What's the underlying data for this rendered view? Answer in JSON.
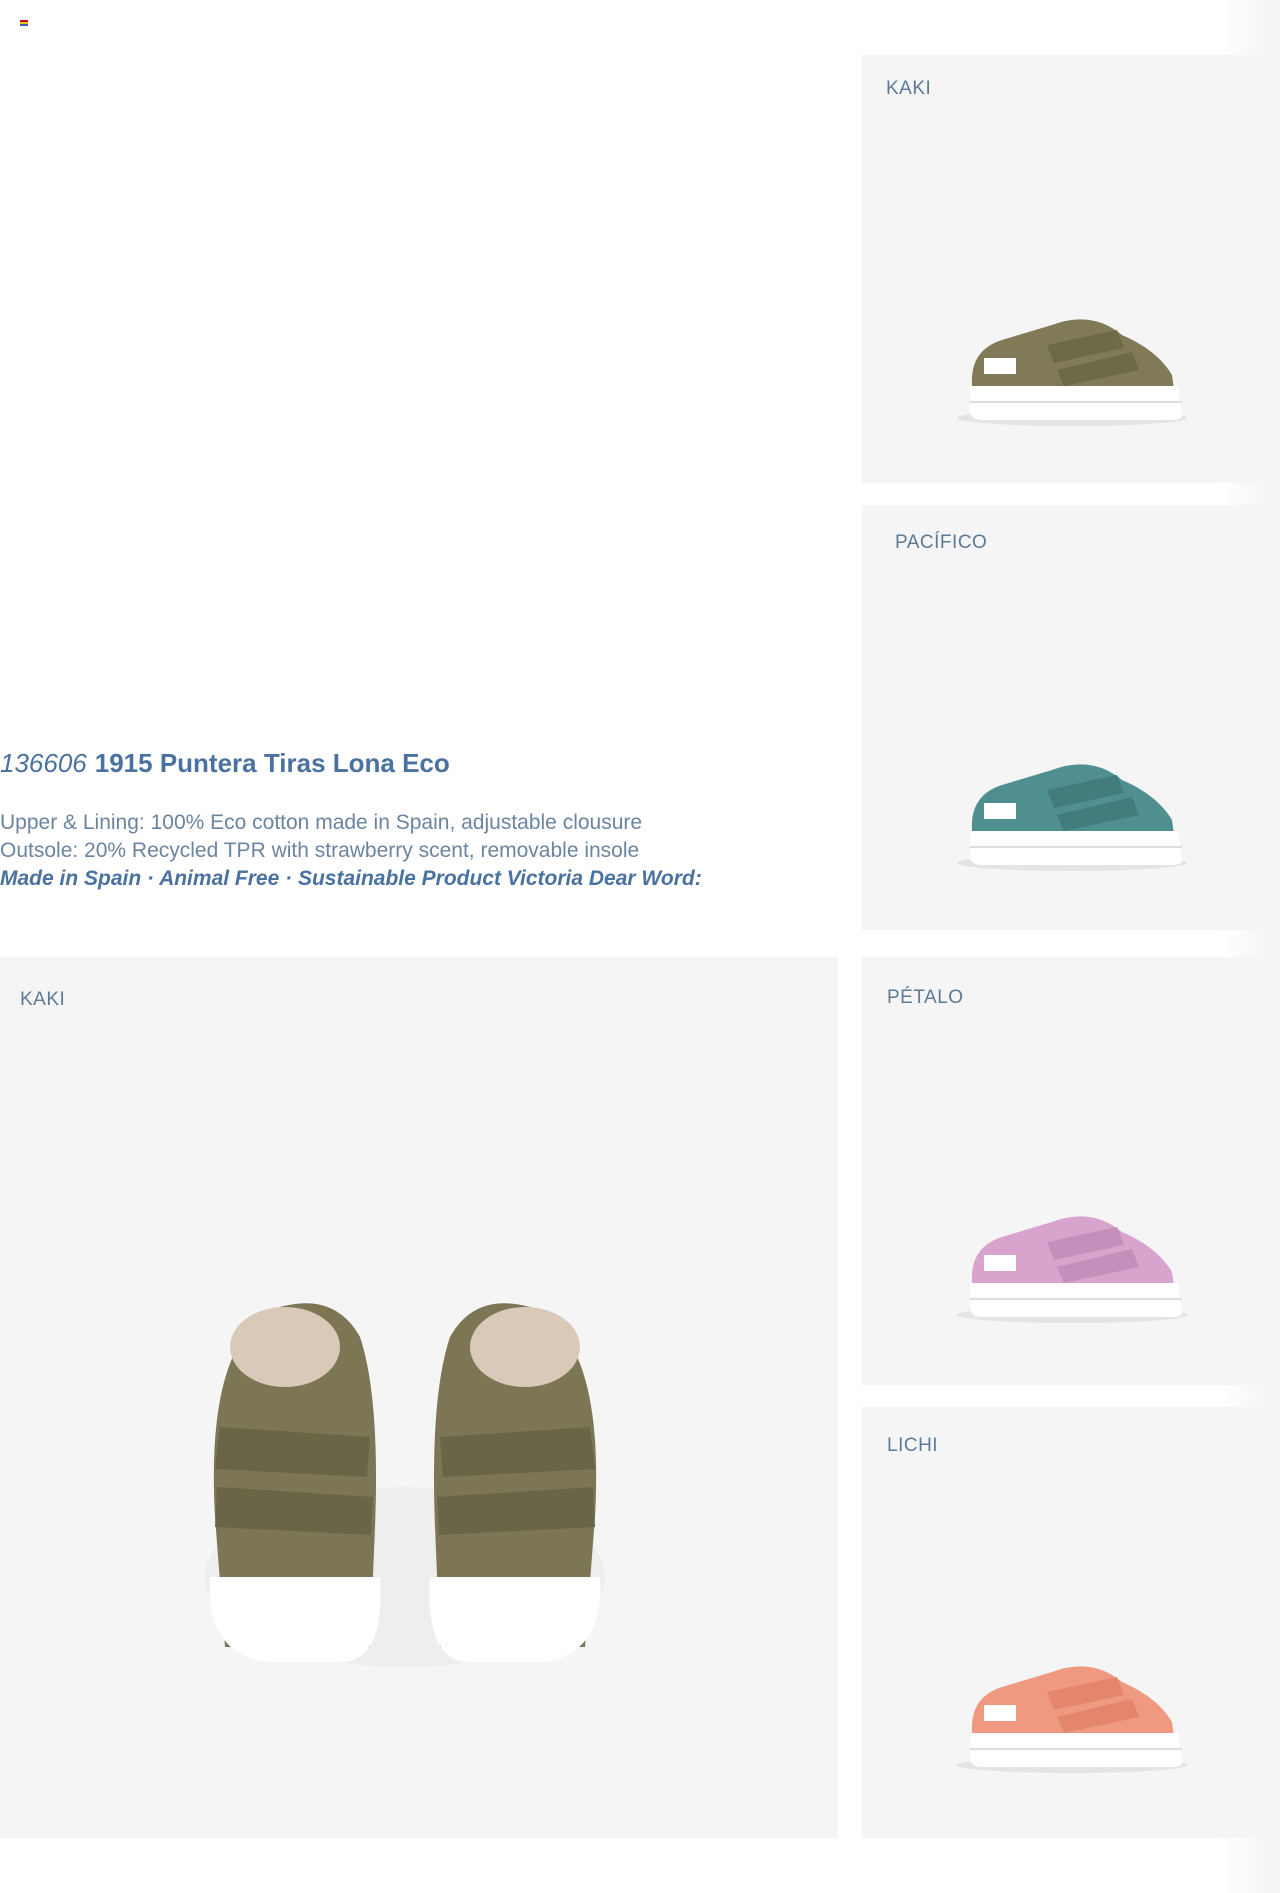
{
  "header": {
    "flag_icon": "spain-flag-icon"
  },
  "product": {
    "code": "136606",
    "name": "1915 Puntera Tiras Lona Eco",
    "line1": "Upper & Lining: 100% Eco cotton made in Spain, adjustable clousure",
    "line2": "Outsole: 20% Recycled TPR with strawberry scent, removable insole",
    "line3": "Made in Spain · Animal Free · Sustainable Product Victoria Dear Word:"
  },
  "variants": [
    {
      "label": "KAKI",
      "color": "#807a56"
    },
    {
      "label": "PACÍFICO",
      "color": "#4f8f8f"
    },
    {
      "label": "PÉTALO",
      "color": "#d8a3cd"
    },
    {
      "label": "LICHI",
      "color": "#ef9a80"
    }
  ],
  "main_photo": {
    "label": "KAKI",
    "color": "#7c7654"
  },
  "colors": {
    "accent": "#4a72a0",
    "text_muted": "#6b84a0",
    "card_bg": "#f5f5f5"
  }
}
